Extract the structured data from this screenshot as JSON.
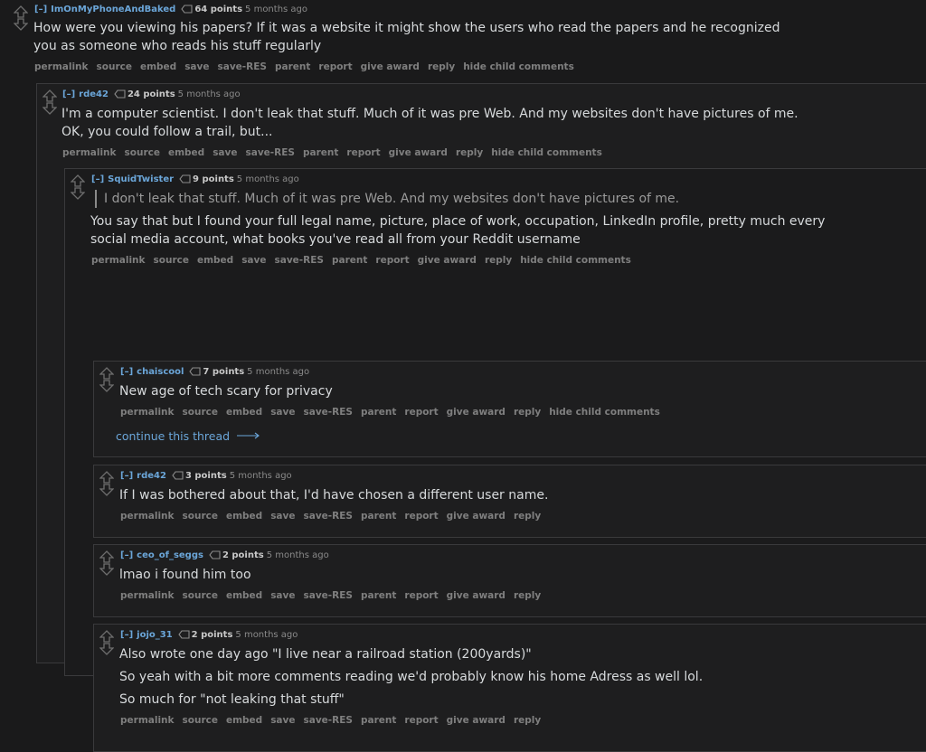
{
  "toggle": "[–]",
  "buttons_full": [
    "permalink",
    "source",
    "embed",
    "save",
    "save-RES",
    "parent",
    "report",
    "give award",
    "reply",
    "hide child comments"
  ],
  "buttons_short": [
    "permalink",
    "source",
    "embed",
    "save",
    "save-RES",
    "parent",
    "report",
    "give award",
    "reply"
  ],
  "c1": {
    "author": "ImOnMyPhoneAndBaked",
    "points": "64 points",
    "time": "5 months ago",
    "line1": "How were you viewing his papers? If it was a website it might show the users who read the papers and he recognized",
    "line2": "you as someone who reads his stuff regularly"
  },
  "c2": {
    "author": "rde42",
    "points": "24 points",
    "time": "5 months ago",
    "line1": "I'm a computer scientist. I don't leak that stuff. Much of it was pre Web. And my websites don't have pictures of me.",
    "line2": "OK, you could follow a trail, but..."
  },
  "c3": {
    "author": "SquidTwister",
    "points": "9 points",
    "time": "5 months ago",
    "quote": "I don't leak that stuff. Much of it was pre Web. And my websites don't have pictures of me.",
    "line1": "You say that but I found your full legal name, picture, place of work, occupation, LinkedIn profile, pretty much every",
    "line2": "social media account, what books you've read all from your Reddit username"
  },
  "c4": {
    "author": "chaiscool",
    "points": "7 points",
    "time": "5 months ago",
    "line1": "New age of tech scary for privacy",
    "continue": "continue this thread"
  },
  "c5": {
    "author": "rde42",
    "points": "3 points",
    "time": "5 months ago",
    "line1": "If I was bothered about that, I'd have chosen a different user name."
  },
  "c6": {
    "author": "ceo_of_seggs",
    "points": "2 points",
    "time": "5 months ago",
    "line1": "lmao i found him too"
  },
  "c7": {
    "author": "jojo_31",
    "points": "2 points",
    "time": "5 months ago",
    "line1": "Also wrote one day ago \"I live near a railroad station (200yards)\"",
    "line2": "So yeah with a bit more comments reading we'd probably know his home Adress as well lol.",
    "line3": "So much for \"not leaking that stuff\""
  }
}
